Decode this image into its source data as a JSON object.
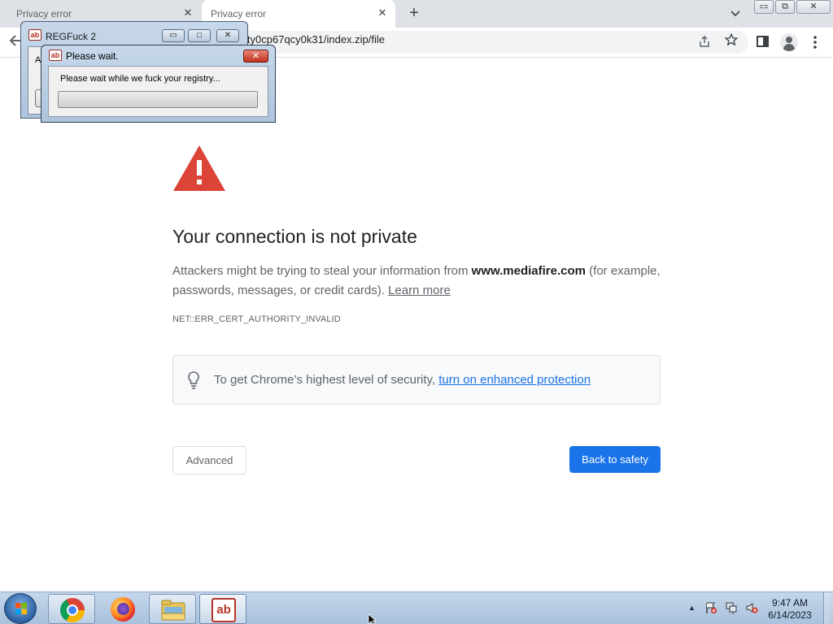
{
  "browser": {
    "tabs": [
      {
        "title": "Privacy error",
        "close": "✕"
      },
      {
        "title": "Privacy error",
        "close": "✕"
      }
    ],
    "new_tab": "+",
    "url_visible": "diafire.com/file/vty0cp67qcy0k31/index.zip/file",
    "window_controls": {
      "minimize": "▭",
      "restore": "⧉",
      "close": "✕"
    }
  },
  "interstitial": {
    "heading": "Your connection is not private",
    "desc_prefix": "Attackers might be trying to steal your information from ",
    "desc_domain": "www.mediafire.com",
    "desc_suffix": " (for example, passwords, messages, or credit cards). ",
    "learn_more": "Learn more",
    "error_code": "NET::ERR_CERT_AUTHORITY_INVALID",
    "enhanced_text": "To get Chrome’s highest level of security, ",
    "enhanced_link": "turn on enhanced protection",
    "advanced_label": "Advanced",
    "back_label": "Back to safety"
  },
  "reg_window": {
    "title": "REGFuck 2",
    "client_text": "Ar",
    "icon_text": "ab"
  },
  "wait_dialog": {
    "title": "Please wait.",
    "message": "Please wait while we fuck your registry...",
    "icon_text": "ab",
    "close": "✕",
    "progress": 0
  },
  "taskbar": {
    "abc_label": "ab",
    "clock_time": "9:47 AM",
    "clock_date": "6/14/2023"
  },
  "colors": {
    "accent": "#1a73e8",
    "warning_red": "#db4437"
  }
}
